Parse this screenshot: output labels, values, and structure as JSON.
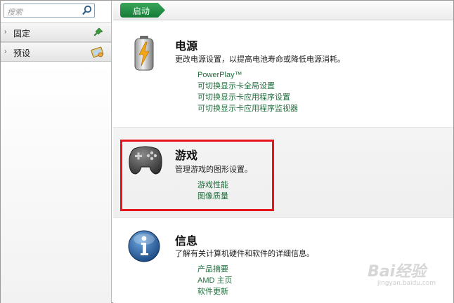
{
  "sidebar": {
    "search": {
      "placeholder": "搜索"
    },
    "items": [
      {
        "label": "固定",
        "icon": "pin-icon"
      },
      {
        "label": "预设",
        "icon": "preset-icon"
      }
    ]
  },
  "topbar": {
    "start_tab": "启动"
  },
  "sections": {
    "power": {
      "title": "电源",
      "description": "更改电源设置，以提高电池寿命或降低电源消耗。",
      "links": [
        "PowerPlay™",
        "可切换显示卡全局设置",
        "可切换显示卡应用程序设置",
        "可切换显示卡应用程序监视器"
      ],
      "icon": "battery-icon"
    },
    "gaming": {
      "title": "游戏",
      "description": "管理游戏的图形设置。",
      "links": [
        "游戏性能",
        "图像质量"
      ],
      "icon": "gamepad-icon"
    },
    "info": {
      "title": "信息",
      "description": "了解有关计算机硬件和软件的详细信息。",
      "links": [
        "产品摘要",
        "AMD 主页",
        "软件更新"
      ],
      "icon": "info-icon"
    }
  },
  "colors": {
    "accent_green": "#137a36",
    "link_green": "#1f6e3c",
    "highlight_red": "#e8141b"
  },
  "watermark": {
    "brand": "Bai经验",
    "url": "jingyan.baidu.com"
  }
}
